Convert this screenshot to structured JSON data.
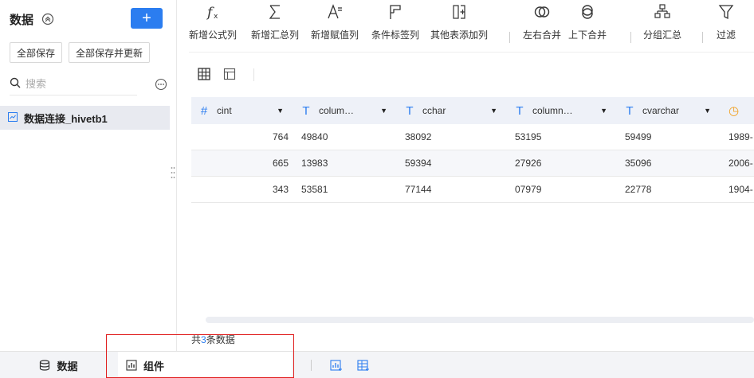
{
  "left_panel": {
    "title": "数据",
    "add_label": "+",
    "save_all": "全部保存",
    "save_all_update": "全部保存并更新",
    "search_placeholder": "搜索",
    "datasource": "数据连接_hivetb1"
  },
  "toolbar": {
    "items": [
      {
        "label": "新增公式列",
        "icon": "formula-icon"
      },
      {
        "label": "新增汇总列",
        "icon": "sum-icon"
      },
      {
        "label": "新增赋值列",
        "icon": "assign-icon"
      },
      {
        "label": "条件标签列",
        "icon": "flag-icon"
      },
      {
        "label": "其他表添加列",
        "icon": "add-column-icon"
      },
      {
        "label": "左右合并",
        "icon": "merge-horizontal-icon"
      },
      {
        "label": "上下合并",
        "icon": "merge-vertical-icon"
      },
      {
        "label": "分组汇总",
        "icon": "group-icon"
      },
      {
        "label": "过滤",
        "icon": "filter-icon"
      }
    ]
  },
  "table": {
    "columns": [
      {
        "type_icon": "#",
        "name": "cint",
        "type": "number"
      },
      {
        "type_icon": "T",
        "name": "colum…",
        "type": "text"
      },
      {
        "type_icon": "T",
        "name": "cchar",
        "type": "text"
      },
      {
        "type_icon": "T",
        "name": "column…",
        "type": "text"
      },
      {
        "type_icon": "T",
        "name": "cvarchar",
        "type": "text"
      },
      {
        "type_icon": "◷",
        "name": "",
        "type": "date"
      }
    ],
    "rows": [
      [
        "764",
        "49840",
        "38092",
        "53195",
        "59499",
        "1989-"
      ],
      [
        "665",
        "13983",
        "59394",
        "27926",
        "35096",
        "2006-"
      ],
      [
        "343",
        "53581",
        "77144",
        "07979",
        "22778",
        "1904-"
      ]
    ]
  },
  "footer": {
    "prefix": "共",
    "count": "3",
    "suffix": "条数据"
  },
  "bottom_bar": {
    "data_tab": "数据",
    "component_tab": "组件"
  },
  "colors": {
    "accent": "#2b7df0",
    "highlight_box": "#e02020"
  }
}
